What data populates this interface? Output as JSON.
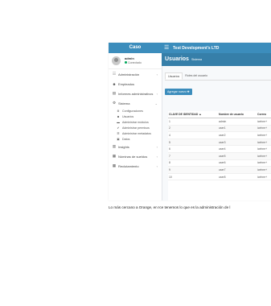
{
  "sidebar": {
    "brand": "Caso",
    "user": {
      "name": "admin",
      "status": "Conectado"
    },
    "items": [
      {
        "icon": "people-icon",
        "glyph": "☷",
        "label": "Administración",
        "chev": "‹"
      },
      {
        "icon": "user-icon",
        "glyph": "☻",
        "label": "Empleados",
        "chev": ""
      },
      {
        "icon": "file-icon",
        "glyph": "▤",
        "label": "Informes administrativos",
        "chev": "‹"
      },
      {
        "icon": "gear-icon",
        "glyph": "⚙",
        "label": "Sistema",
        "chev": "⌄"
      }
    ],
    "submenu": [
      {
        "icon": "gear-icon",
        "glyph": "⚙",
        "label": "Configuraciones"
      },
      {
        "icon": "user-icon",
        "glyph": "☻",
        "label": "Usuarios"
      },
      {
        "icon": "folder-icon",
        "glyph": "▬",
        "label": "Administrar módulos"
      },
      {
        "icon": "check-icon",
        "glyph": "✔",
        "label": "Administrar permisos"
      },
      {
        "icon": "list-icon",
        "glyph": "☰",
        "label": "Administrar metadatos"
      },
      {
        "icon": "trash-icon",
        "glyph": "▣",
        "label": "Datos"
      }
    ],
    "items_after": [
      {
        "icon": "chart-icon",
        "glyph": "▥",
        "label": "Insights",
        "chev": "‹"
      },
      {
        "icon": "pricetag-icon",
        "glyph": "▦",
        "label": "Nóminas de sueldos",
        "chev": "‹"
      },
      {
        "icon": "recruit-icon",
        "glyph": "▦",
        "label": "Reclutamiento",
        "chev": "‹"
      }
    ]
  },
  "topbar": {
    "company": "Test Development's LTD"
  },
  "page": {
    "title": "Usuarios",
    "subtitle": "Sistema"
  },
  "tabs": [
    "Usuarios",
    "Roles del usuario"
  ],
  "add_button": "Agregar nuevo ✚",
  "table": {
    "headers": [
      "CLAVE DE IDENTIDAD",
      "Nombre de usuario",
      "Correo"
    ],
    "sort_marker": "▲",
    "rows": [
      [
        "1",
        "admin",
        "icehrm+"
      ],
      [
        "2",
        "user1",
        "icehrm+"
      ],
      [
        "4",
        "user2",
        "icehrm+"
      ],
      [
        "5",
        "user3",
        "icehrm+"
      ],
      [
        "6",
        "user4",
        "icehrm+"
      ],
      [
        "7",
        "user5",
        "icehrm+"
      ],
      [
        "8",
        "user6",
        "icehrm+"
      ],
      [
        "9",
        "user7",
        "icehrm+"
      ],
      [
        "10",
        "user8",
        "icehrm+"
      ]
    ]
  },
  "caption": "Lo más cercano a Orange, en Ice tenemos lo que es la administración de l"
}
